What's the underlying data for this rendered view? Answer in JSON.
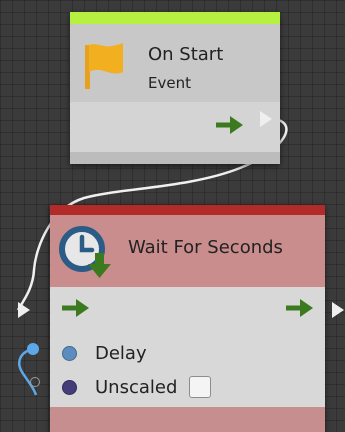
{
  "colors": {
    "canvas_bg": "#3b3b3b",
    "start_accent": "#b6f040",
    "wait_accent": "#b32a2a",
    "wait_body": "#c59090",
    "flow_arrow": "#3b7a1e",
    "float_port": "#5b8ebf",
    "bool_port": "#443d7a"
  },
  "nodes": {
    "on_start": {
      "title": "On Start",
      "subtitle": "Event",
      "icon": "flag-icon"
    },
    "wait_for_seconds": {
      "title": "Wait For Seconds",
      "icon": "clock-download-icon",
      "inputs": [
        {
          "label": "Delay",
          "port_type": "float"
        },
        {
          "label": "Unscaled",
          "port_type": "bool",
          "checked": false
        }
      ]
    }
  }
}
